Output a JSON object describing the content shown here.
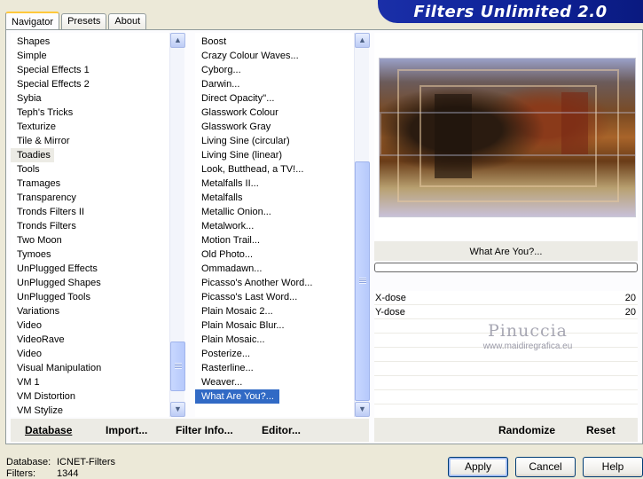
{
  "tabs": [
    {
      "label": "Navigator",
      "active": true
    },
    {
      "label": "Presets",
      "active": false
    },
    {
      "label": "About",
      "active": false
    }
  ],
  "title": "Filters Unlimited 2.0",
  "categories": {
    "items": [
      "Shapes",
      "Simple",
      "Special Effects 1",
      "Special Effects 2",
      "Sybia",
      "Teph's Tricks",
      "Texturize",
      "Tile & Mirror",
      "Toadies",
      "Tools",
      "Tramages",
      "Transparency",
      "Tronds Filters II",
      "Tronds Filters",
      "Two Moon",
      "Tymoes",
      "UnPlugged Effects",
      "UnPlugged Shapes",
      "UnPlugged Tools",
      "Variations",
      "Video",
      "VideoRave",
      "Video",
      "Visual Manipulation",
      "VM 1",
      "VM Distortion",
      "VM Stylize"
    ],
    "selected": "Toadies"
  },
  "filters": {
    "items": [
      "Boost",
      "Crazy Colour Waves...",
      "Cyborg...",
      "Darwin...",
      "Direct Opacity''...",
      "Glasswork Colour",
      "Glasswork Gray",
      "Living Sine (circular)",
      "Living Sine (linear)",
      "Look, Butthead, a TV!...",
      "Metalfalls II...",
      "Metalfalls",
      "Metallic Onion...",
      "Metalwork...",
      "Motion Trail...",
      "Old Photo...",
      "Ommadawn...",
      "Picasso's Another Word...",
      "Picasso's Last Word...",
      "Plain Mosaic 2...",
      "Plain Mosaic Blur...",
      "Plain Mosaic...",
      "Posterize...",
      "Rasterline...",
      "Weaver...",
      "What Are You?..."
    ],
    "selected": "What Are You?..."
  },
  "preview": {
    "filter_name": "What Are You?...",
    "progress": 0
  },
  "params": [
    {
      "name": "X-dose",
      "value": "20"
    },
    {
      "name": "Y-dose",
      "value": "20"
    }
  ],
  "watermark": {
    "line1": "Pinuccia",
    "line2": "www.maidiregrafica.eu"
  },
  "left_buttons": {
    "database": "Database",
    "import": "Import...",
    "filter_info": "Filter Info...",
    "editor": "Editor..."
  },
  "right_buttons": {
    "randomize": "Randomize",
    "reset": "Reset"
  },
  "status": {
    "database_label": "Database:",
    "database_value": "ICNET-Filters",
    "filters_label": "Filters:",
    "filters_value": "1344"
  },
  "dialog_buttons": {
    "apply": "Apply",
    "cancel": "Cancel",
    "help": "Help"
  },
  "icons": {
    "scroll_up": "scroll-up-arrow-icon",
    "scroll_down": "scroll-down-arrow-icon"
  }
}
